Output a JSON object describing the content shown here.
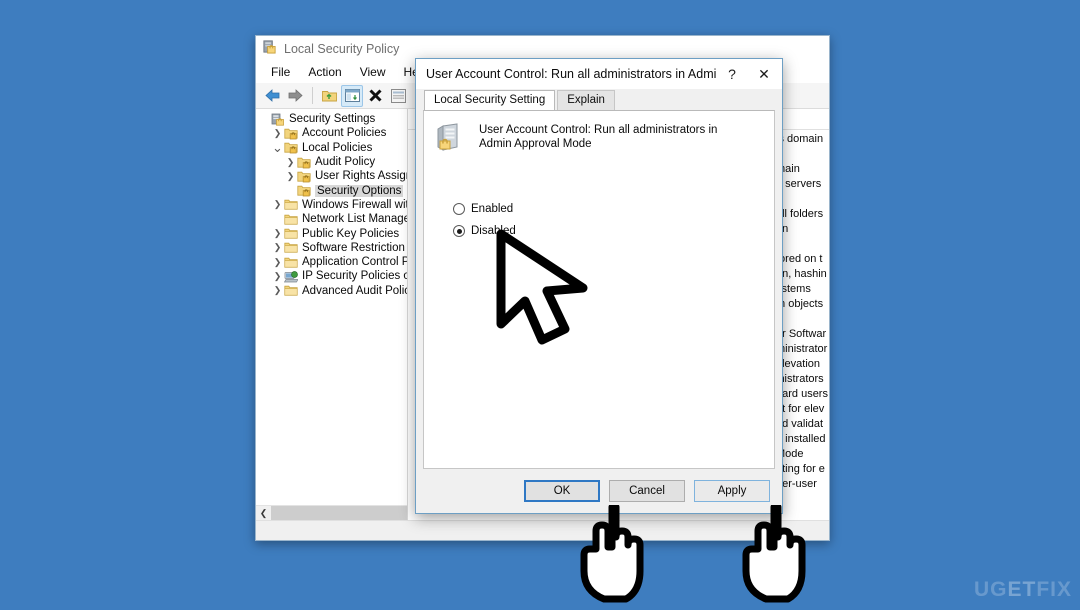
{
  "desktop": {
    "background_color": "#3e7dbf",
    "watermark": {
      "prefix": "UG",
      "middle": "ET",
      "suffix": "FIX"
    }
  },
  "mmc_window": {
    "title": "Local Security Policy",
    "title_icon": "security-policy-icon",
    "menu": [
      {
        "label": "File",
        "name": "menu-file"
      },
      {
        "label": "Action",
        "name": "menu-action"
      },
      {
        "label": "View",
        "name": "menu-view"
      },
      {
        "label": "Help",
        "name": "menu-help"
      }
    ],
    "toolbar": [
      {
        "name": "back-icon",
        "glyph": "back-arrow"
      },
      {
        "name": "forward-icon",
        "glyph": "forward-arrow"
      },
      {
        "name": "separator",
        "glyph": "separator"
      },
      {
        "name": "up-folder-icon",
        "glyph": "up-folder"
      },
      {
        "name": "show-hide-tree-icon",
        "glyph": "tree-pane",
        "pressed": true
      },
      {
        "name": "delete-icon",
        "glyph": "x-mark"
      },
      {
        "name": "properties-icon",
        "glyph": "properties"
      },
      {
        "name": "export-list-icon",
        "glyph": "export"
      }
    ],
    "tree": [
      {
        "label": "Security Settings",
        "level": 0,
        "expander": "",
        "icon": "security-settings-icon",
        "selected": false
      },
      {
        "label": "Account Policies",
        "level": 1,
        "expander": "collapsed",
        "icon": "folder-lock-icon",
        "selected": false
      },
      {
        "label": "Local Policies",
        "level": 1,
        "expander": "expanded",
        "icon": "folder-lock-icon",
        "selected": false
      },
      {
        "label": "Audit Policy",
        "level": 2,
        "expander": "collapsed",
        "icon": "folder-lock-icon",
        "selected": false
      },
      {
        "label": "User Rights Assignment",
        "level": 2,
        "expander": "collapsed",
        "icon": "folder-lock-icon",
        "selected": false
      },
      {
        "label": "Security Options",
        "level": 2,
        "expander": "",
        "icon": "folder-lock-icon",
        "selected": true
      },
      {
        "label": "Windows Firewall with Advanced Security",
        "level": 1,
        "expander": "collapsed",
        "icon": "folder-icon",
        "selected": false
      },
      {
        "label": "Network List Manager Policies",
        "level": 1,
        "expander": "",
        "icon": "folder-icon",
        "selected": false
      },
      {
        "label": "Public Key Policies",
        "level": 1,
        "expander": "collapsed",
        "icon": "folder-icon",
        "selected": false
      },
      {
        "label": "Software Restriction Policies",
        "level": 1,
        "expander": "collapsed",
        "icon": "folder-icon",
        "selected": false
      },
      {
        "label": "Application Control Policies",
        "level": 1,
        "expander": "collapsed",
        "icon": "folder-icon",
        "selected": false
      },
      {
        "label": "IP Security Policies on Local Computer",
        "level": 1,
        "expander": "collapsed",
        "icon": "ip-security-icon",
        "selected": false
      },
      {
        "label": "Advanced Audit Policy Configuration",
        "level": 1,
        "expander": "collapsed",
        "icon": "folder-icon",
        "selected": false
      }
    ],
    "list_rows": [
      "is domain",
      "",
      "main",
      "e servers",
      "",
      " all folders",
      " on",
      "",
      "tored on t",
      "on, hashin",
      "ystems",
      "m objects",
      "",
      "or Softwar",
      "ministrator",
      " elevation",
      "inistrators",
      "dard users",
      "pt for elev",
      "nd validat",
      "e installed",
      "Mode",
      "oting for e",
      " per-user"
    ]
  },
  "dialog": {
    "title": "User Account Control: Run all administrators in Admin Ap...",
    "help_label": "?",
    "close_label": "✕",
    "tabs": [
      {
        "label": "Local Security Setting",
        "active": true
      },
      {
        "label": "Explain",
        "active": false
      }
    ],
    "policy_icon": "policy-setting-icon",
    "policy_title": "User Account Control: Run all administrators in Admin Approval Mode",
    "options": [
      {
        "label": "Enabled",
        "checked": false
      },
      {
        "label": "Disabled",
        "checked": true
      }
    ],
    "buttons": [
      {
        "label": "OK",
        "style": "default",
        "name": "ok-button"
      },
      {
        "label": "Cancel",
        "style": "normal",
        "name": "cancel-button"
      },
      {
        "label": "Apply",
        "style": "focus-light",
        "name": "apply-button"
      }
    ]
  },
  "cursors": {
    "arrow": "mouse-pointer-arrow",
    "hand_ok": "pointing-hand-over-ok",
    "hand_apply": "pointing-hand-over-apply"
  }
}
